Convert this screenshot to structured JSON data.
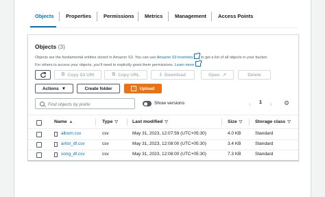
{
  "tabs": [
    "Objects",
    "Properties",
    "Permissions",
    "Metrics",
    "Management",
    "Access Points"
  ],
  "panel": {
    "title": "Objects",
    "count": "(3)",
    "desc_1": "Objects are the fundamental entities stored in Amazon S3. You can use ",
    "desc_link_1": "Amazon S3 inventory",
    "desc_2": " to get a list of all objects in your bucket.",
    "desc_3": "For others to access your objects, you'll need to explicitly grant them permissions. ",
    "desc_link_2": "Learn more"
  },
  "toolbar": {
    "copy_s3_uri": "Copy S3 URI",
    "copy_url": "Copy URL",
    "download": "Download",
    "open": "Open",
    "delete": "Delete",
    "actions": "Actions",
    "create_folder": "Create folder",
    "upload": "Upload"
  },
  "search": {
    "placeholder": "Find objects by prefix"
  },
  "show_versions": "Show versions",
  "pagination": {
    "page": "1"
  },
  "table": {
    "columns": [
      "Name",
      "Type",
      "Last modified",
      "Size",
      "Storage class"
    ],
    "rows": [
      {
        "name": "album.csv",
        "type": "csv",
        "modified": "May 31, 2023, 12:07:59 (UTC+05:30)",
        "size": "4.0 KB",
        "storage": "Standard"
      },
      {
        "name": "artist_df.csv",
        "type": "csv",
        "modified": "May 31, 2023, 12:08:00 (UTC+05:30)",
        "size": "3.4 KB",
        "storage": "Standard"
      },
      {
        "name": "song_df.csv",
        "type": "csv",
        "modified": "May 31, 2023, 12:08:00 (UTC+05:30)",
        "size": "7.3 KB",
        "storage": "Standard"
      }
    ]
  },
  "colors": {
    "accent": "#0073bb",
    "primary": "#ec7211",
    "border": "#d5dbdb"
  }
}
